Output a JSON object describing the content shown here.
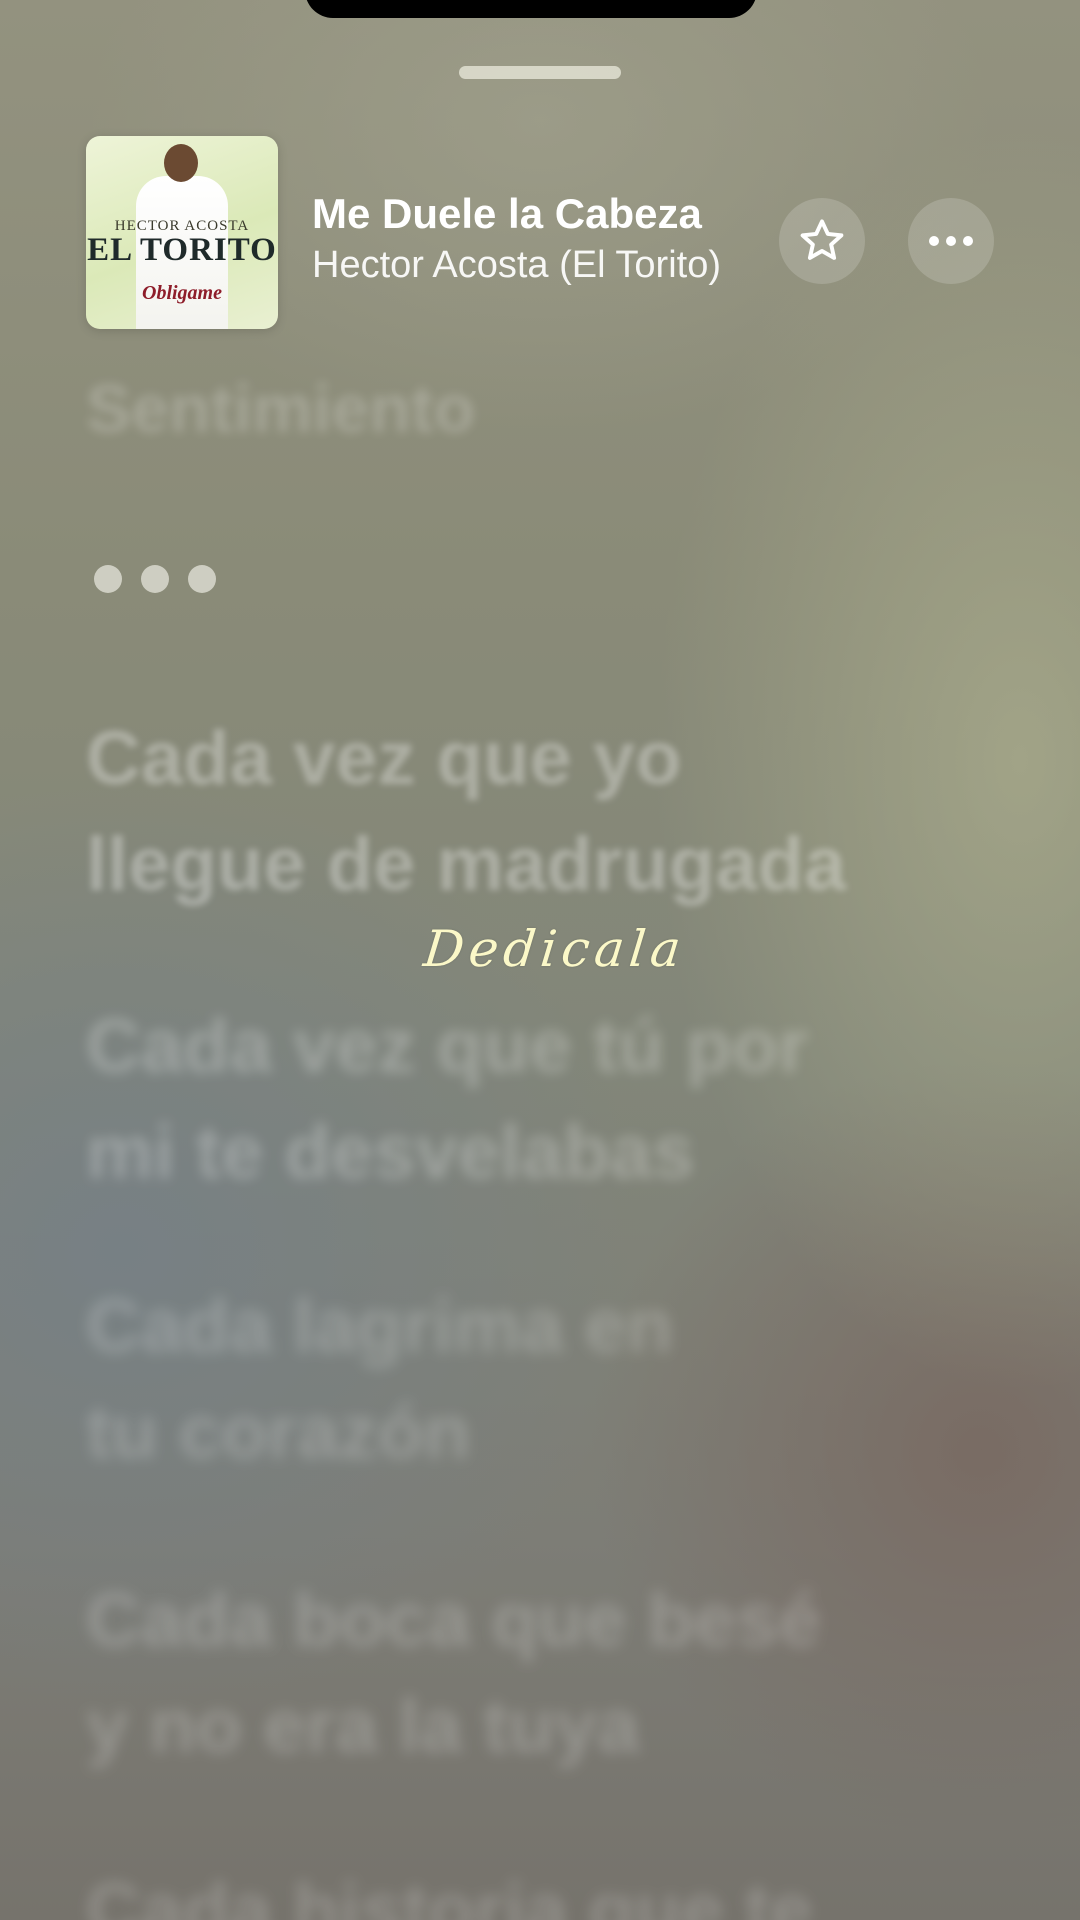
{
  "now_playing": {
    "title": "Me Duele la Cabeza",
    "artist": "Hector Acosta (El Torito)",
    "artwork": {
      "top_text": "HECTOR ACOSTA",
      "main_text": "EL TORITO",
      "album_text": "Obligame"
    },
    "favorite_icon": "star-outline-icon",
    "more_icon": "ellipsis-icon"
  },
  "lyrics": {
    "previous_line": "Sentimiento",
    "instrumental_indicator": "•••",
    "blocks": [
      [
        "Cada vez que yo",
        "llegue de madrugada"
      ],
      [
        "Cada vez que tú por",
        "mi te desvelabas"
      ],
      [
        "Cada lagrima en",
        "tu corazón"
      ],
      [
        "Cada boca que besé",
        "y no era la tuya"
      ],
      [
        "Cada historia que te"
      ]
    ]
  },
  "overlay": {
    "handwritten_text": "Dedicala",
    "color": "#fbf8c8"
  },
  "theme": {
    "accent": "#ffffff"
  }
}
